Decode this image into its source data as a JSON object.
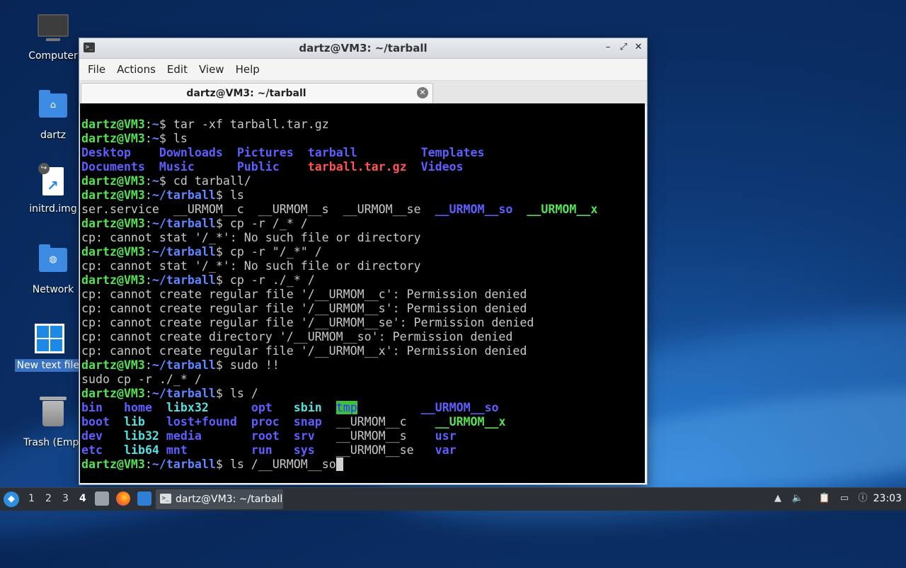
{
  "desktop": {
    "icons": [
      {
        "label": "Computer",
        "icon": "computer-icon"
      },
      {
        "label": "dartz",
        "icon": "home-folder-icon"
      },
      {
        "label": "initrd.img",
        "icon": "symlink-file-icon"
      },
      {
        "label": "Network",
        "icon": "network-folder-icon"
      },
      {
        "label": "New text file.",
        "icon": "windows-file-icon"
      },
      {
        "label": "Trash (Empt",
        "icon": "trash-icon"
      }
    ]
  },
  "window": {
    "title": "dartz@VM3: ~/tarball",
    "controls": {
      "minimize": "–",
      "maximize": "⤢",
      "close": "✕"
    },
    "menu": [
      "File",
      "Actions",
      "Edit",
      "View",
      "Help"
    ],
    "tab": {
      "label": "dartz@VM3: ~/tarball"
    }
  },
  "terminal": {
    "lines": [
      [
        {
          "t": "dartz@VM3",
          "c": "pu"
        },
        {
          "t": ":",
          "c": ""
        },
        {
          "t": "~",
          "c": "pp"
        },
        {
          "t": "$ tar -xf tarball.tar.gz",
          "c": ""
        }
      ],
      [
        {
          "t": "dartz@VM3",
          "c": "pu"
        },
        {
          "t": ":",
          "c": ""
        },
        {
          "t": "~",
          "c": "pp"
        },
        {
          "t": "$ ls",
          "c": ""
        }
      ],
      [
        {
          "t": "Desktop",
          "c": "dir"
        },
        {
          "t": "    ",
          "c": ""
        },
        {
          "t": "Downloads",
          "c": "dir"
        },
        {
          "t": "  ",
          "c": ""
        },
        {
          "t": "Pictures",
          "c": "dir"
        },
        {
          "t": "  ",
          "c": ""
        },
        {
          "t": "tarball",
          "c": "dir"
        },
        {
          "t": "         ",
          "c": ""
        },
        {
          "t": "Templates",
          "c": "dir"
        }
      ],
      [
        {
          "t": "Documents",
          "c": "dir"
        },
        {
          "t": "  ",
          "c": ""
        },
        {
          "t": "Music",
          "c": "dir"
        },
        {
          "t": "      ",
          "c": ""
        },
        {
          "t": "Public",
          "c": "dir"
        },
        {
          "t": "    ",
          "c": ""
        },
        {
          "t": "tarball.tar.gz",
          "c": "arch"
        },
        {
          "t": "  ",
          "c": ""
        },
        {
          "t": "Videos",
          "c": "dir"
        }
      ],
      [
        {
          "t": "dartz@VM3",
          "c": "pu"
        },
        {
          "t": ":",
          "c": ""
        },
        {
          "t": "~",
          "c": "pp"
        },
        {
          "t": "$ cd tarball/",
          "c": ""
        }
      ],
      [
        {
          "t": "dartz@VM3",
          "c": "pu"
        },
        {
          "t": ":",
          "c": ""
        },
        {
          "t": "~/tarball",
          "c": "pp"
        },
        {
          "t": "$ ls",
          "c": ""
        }
      ],
      [
        {
          "t": "ser.service  __URMOM__c  __URMOM__s  __URMOM__se  ",
          "c": ""
        },
        {
          "t": "__URMOM__so",
          "c": "dir"
        },
        {
          "t": "  ",
          "c": ""
        },
        {
          "t": "__URMOM__x",
          "c": "exe"
        }
      ],
      [
        {
          "t": "dartz@VM3",
          "c": "pu"
        },
        {
          "t": ":",
          "c": ""
        },
        {
          "t": "~/tarball",
          "c": "pp"
        },
        {
          "t": "$ cp -r /_* /",
          "c": ""
        }
      ],
      [
        {
          "t": "cp: cannot stat '/_*': No such file or directory",
          "c": ""
        }
      ],
      [
        {
          "t": "dartz@VM3",
          "c": "pu"
        },
        {
          "t": ":",
          "c": ""
        },
        {
          "t": "~/tarball",
          "c": "pp"
        },
        {
          "t": "$ cp -r \"/_*\" /",
          "c": ""
        }
      ],
      [
        {
          "t": "cp: cannot stat '/_*': No such file or directory",
          "c": ""
        }
      ],
      [
        {
          "t": "dartz@VM3",
          "c": "pu"
        },
        {
          "t": ":",
          "c": ""
        },
        {
          "t": "~/tarball",
          "c": "pp"
        },
        {
          "t": "$ cp -r ./_* /",
          "c": ""
        }
      ],
      [
        {
          "t": "cp: cannot create regular file '/__URMOM__c': Permission denied",
          "c": ""
        }
      ],
      [
        {
          "t": "cp: cannot create regular file '/__URMOM__s': Permission denied",
          "c": ""
        }
      ],
      [
        {
          "t": "cp: cannot create regular file '/__URMOM__se': Permission denied",
          "c": ""
        }
      ],
      [
        {
          "t": "cp: cannot create directory '/__URMOM__so': Permission denied",
          "c": ""
        }
      ],
      [
        {
          "t": "cp: cannot create regular file '/__URMOM__x': Permission denied",
          "c": ""
        }
      ],
      [
        {
          "t": "dartz@VM3",
          "c": "pu"
        },
        {
          "t": ":",
          "c": ""
        },
        {
          "t": "~/tarball",
          "c": "pp"
        },
        {
          "t": "$ sudo !!",
          "c": ""
        }
      ],
      [
        {
          "t": "sudo cp -r ./_* /",
          "c": ""
        }
      ],
      [
        {
          "t": "dartz@VM3",
          "c": "pu"
        },
        {
          "t": ":",
          "c": ""
        },
        {
          "t": "~/tarball",
          "c": "pp"
        },
        {
          "t": "$ ls /",
          "c": ""
        }
      ],
      [
        {
          "t": "bin",
          "c": "dir"
        },
        {
          "t": "   ",
          "c": ""
        },
        {
          "t": "home",
          "c": "dir"
        },
        {
          "t": "  ",
          "c": ""
        },
        {
          "t": "libx32",
          "c": "lnk"
        },
        {
          "t": "      ",
          "c": ""
        },
        {
          "t": "opt",
          "c": "dir"
        },
        {
          "t": "   ",
          "c": ""
        },
        {
          "t": "sbin",
          "c": "lnk"
        },
        {
          "t": "  ",
          "c": ""
        },
        {
          "t": "tmp",
          "c": "tmpd"
        },
        {
          "t": "         ",
          "c": ""
        },
        {
          "t": "__URMOM__so",
          "c": "dir"
        }
      ],
      [
        {
          "t": "boot",
          "c": "dir"
        },
        {
          "t": "  ",
          "c": ""
        },
        {
          "t": "lib",
          "c": "lnk"
        },
        {
          "t": "   ",
          "c": ""
        },
        {
          "t": "lost+found",
          "c": "dir"
        },
        {
          "t": "  ",
          "c": ""
        },
        {
          "t": "proc",
          "c": "dir"
        },
        {
          "t": "  ",
          "c": ""
        },
        {
          "t": "snap",
          "c": "dir"
        },
        {
          "t": "  __URMOM__c    ",
          "c": ""
        },
        {
          "t": "__URMOM__x",
          "c": "exe"
        }
      ],
      [
        {
          "t": "dev",
          "c": "dir"
        },
        {
          "t": "   ",
          "c": ""
        },
        {
          "t": "lib32",
          "c": "lnk"
        },
        {
          "t": " ",
          "c": ""
        },
        {
          "t": "media",
          "c": "dir"
        },
        {
          "t": "       ",
          "c": ""
        },
        {
          "t": "root",
          "c": "dir"
        },
        {
          "t": "  ",
          "c": ""
        },
        {
          "t": "srv",
          "c": "dir"
        },
        {
          "t": "   __URMOM__s    ",
          "c": ""
        },
        {
          "t": "usr",
          "c": "dir"
        }
      ],
      [
        {
          "t": "etc",
          "c": "dir"
        },
        {
          "t": "   ",
          "c": ""
        },
        {
          "t": "lib64",
          "c": "lnk"
        },
        {
          "t": " ",
          "c": ""
        },
        {
          "t": "mnt",
          "c": "dir"
        },
        {
          "t": "         ",
          "c": ""
        },
        {
          "t": "run",
          "c": "dir"
        },
        {
          "t": "   ",
          "c": ""
        },
        {
          "t": "sys",
          "c": "dir"
        },
        {
          "t": "   __URMOM__se   ",
          "c": ""
        },
        {
          "t": "var",
          "c": "dir"
        }
      ],
      [
        {
          "t": "dartz@VM3",
          "c": "pu"
        },
        {
          "t": ":",
          "c": ""
        },
        {
          "t": "~/tarball",
          "c": "pp"
        },
        {
          "t": "$ ls /__URMOM__so",
          "c": ""
        }
      ]
    ]
  },
  "taskbar": {
    "workspaces": [
      "1",
      "2",
      "3",
      "4"
    ],
    "active_workspace": "4",
    "task_label": "dartz@VM3: ~/tarball",
    "clock": "23:03"
  }
}
